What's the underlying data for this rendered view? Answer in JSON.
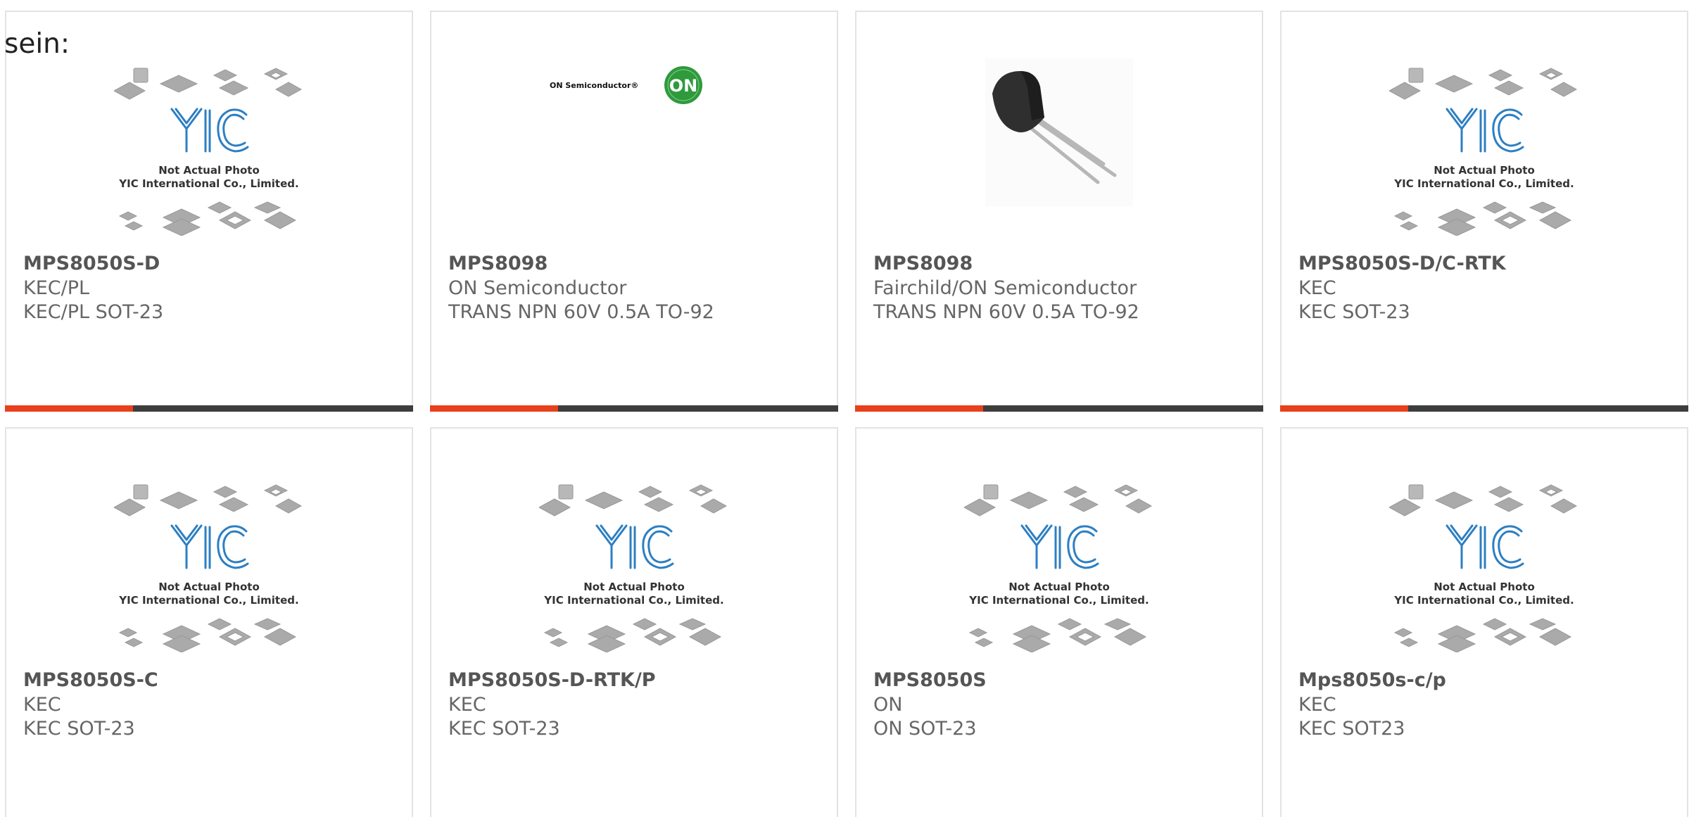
{
  "intro": "sein:",
  "placeholder": {
    "line1": "Not Actual Photo",
    "line2": "YIC International Co., Limited."
  },
  "on_logo": {
    "text": "ON Semiconductor",
    "badge": "ON",
    "colors": {
      "badge": "#2e9a3c",
      "text": "#111111"
    }
  },
  "colors": {
    "accent": "#e8401c",
    "bar": "#3d3d3d",
    "logo_blue": "#2d7fc2",
    "chip_gray": "#a9a9a9"
  },
  "products": [
    {
      "part": "MPS8050S-D",
      "maker": "KEC/PL",
      "desc": "KEC/PL SOT-23",
      "image": "placeholder-logo"
    },
    {
      "part": "MPS8098",
      "maker": "ON Semiconductor",
      "desc": "TRANS NPN 60V 0.5A TO-92",
      "image": "on-semiconductor-logo"
    },
    {
      "part": "MPS8098",
      "maker": "Fairchild/ON Semiconductor",
      "desc": "TRANS NPN 60V 0.5A TO-92",
      "image": "to92-transistor-photo"
    },
    {
      "part": "MPS8050S-D/C-RTK",
      "maker": "KEC",
      "desc": "KEC SOT-23",
      "image": "placeholder-logo"
    },
    {
      "part": "MPS8050S-C",
      "maker": "KEC",
      "desc": "KEC SOT-23",
      "image": "placeholder-logo"
    },
    {
      "part": "MPS8050S-D-RTK/P",
      "maker": "KEC",
      "desc": "KEC SOT-23",
      "image": "placeholder-logo"
    },
    {
      "part": "MPS8050S",
      "maker": "ON",
      "desc": "ON SOT-23",
      "image": "placeholder-logo"
    },
    {
      "part": "Mps8050s-c/p",
      "maker": "KEC",
      "desc": "KEC SOT23",
      "image": "placeholder-logo"
    }
  ]
}
